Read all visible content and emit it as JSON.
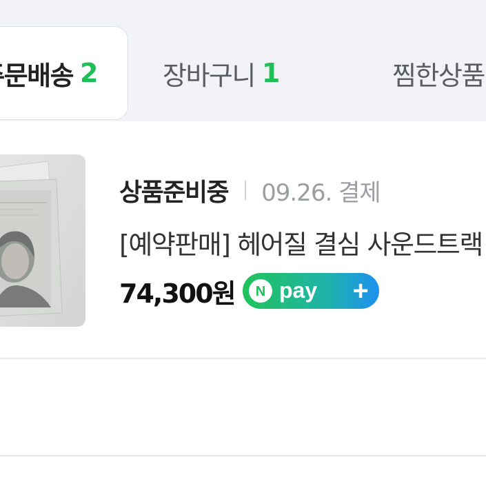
{
  "tabs": [
    {
      "label": "주문배송",
      "count": "2",
      "active": true
    },
    {
      "label": "장바구니",
      "count": "1",
      "active": false
    },
    {
      "label": "찜한상품",
      "count": "",
      "active": false
    }
  ],
  "order": {
    "status": "상품준비중",
    "paid_date": "09.26. 결제",
    "product_name": "[예약판매] 헤어질 결심 사운드트랙",
    "price": "74,300원",
    "pay_badge": {
      "n_letter": "N",
      "text": "pay",
      "plus": "+"
    }
  },
  "colors": {
    "accent_green": "#1fbf58",
    "tab_bar_bg": "#f1f3f6",
    "npay_gradient_start": "#21c35a",
    "npay_gradient_end": "#1e90f0"
  },
  "icons": {
    "npay": "naver-pay-plus-icon"
  }
}
